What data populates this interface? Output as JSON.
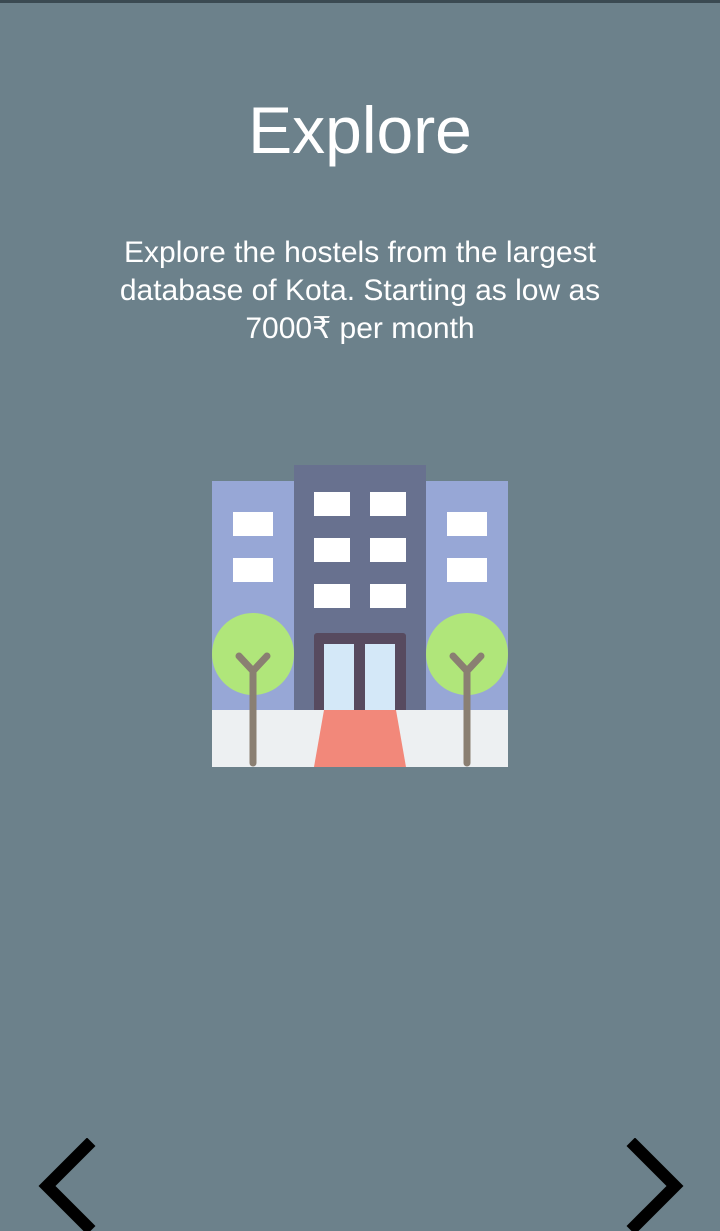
{
  "onboarding": {
    "title": "Explore",
    "description": "Explore the hostels from the largest database of Kota. Starting as low as 7000₹ per month"
  },
  "illustration": {
    "icon": "hostel-building-icon"
  },
  "navigation": {
    "prev_icon": "chevron-left-icon",
    "next_icon": "chevron-right-icon"
  },
  "colors": {
    "background": "#6c818b",
    "text": "#ffffff",
    "center_tower": "#68718f",
    "side_wings": "#97a7d6",
    "tree_canopy": "#b0e67a",
    "tree_trunk": "#8a7f72",
    "door_frame": "#574a5f",
    "door_glass": "#d4e8f8",
    "carpet": "#f2887a",
    "pavement": "#edf0f2",
    "chevron": "#000000"
  }
}
